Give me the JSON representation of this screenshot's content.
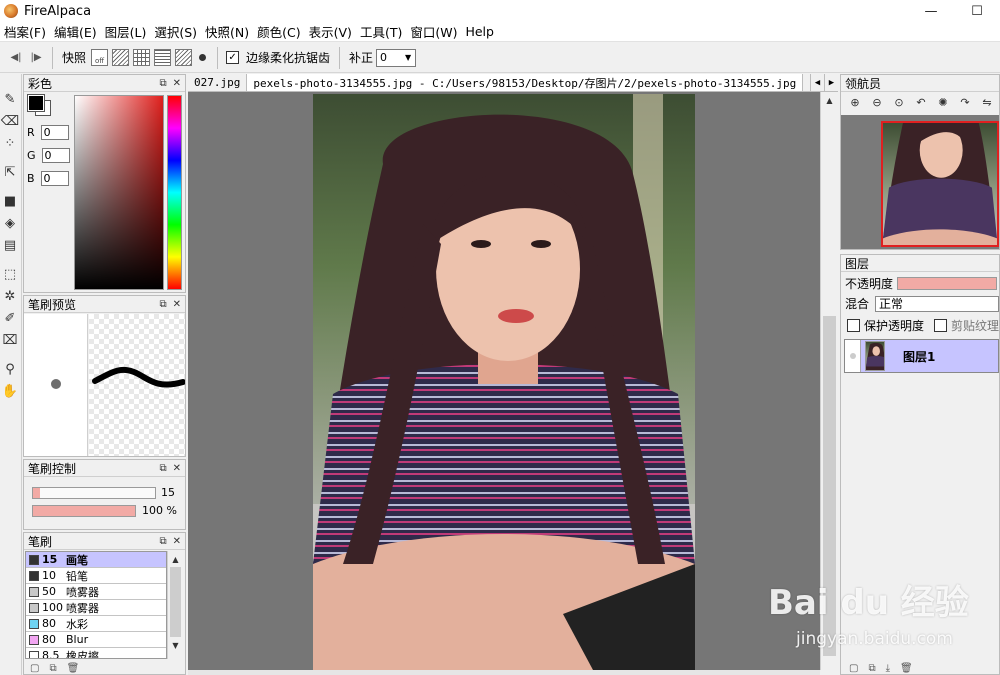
{
  "window": {
    "title": "FireAlpaca",
    "minimize": "—",
    "maximize": "☐"
  },
  "menu": [
    "档案(F)",
    "编辑(E)",
    "图层(L)",
    "選択(S)",
    "快照(N)",
    "颜色(C)",
    "表示(V)",
    "工具(T)",
    "窗口(W)",
    "Help"
  ],
  "toolbar": {
    "snap_label": "快照",
    "snap_off_text": "off",
    "antialias_checked": true,
    "antialias_label": "边缘柔化抗锯齿",
    "correction_label": "补正",
    "correction_value": "0"
  },
  "color_panel": {
    "title": "彩色",
    "r_label": "R",
    "r_value": "0",
    "g_label": "G",
    "g_value": "0",
    "b_label": "B",
    "b_value": "0",
    "fg_color": "#000000",
    "bg_color": "#ffffff",
    "hue_color": "#e0201d"
  },
  "brush_preview": {
    "title": "笔刷预览"
  },
  "brush_control": {
    "title": "笔刷控制",
    "size_value": "15",
    "size_fraction": 0.06,
    "opacity_value": "100 %",
    "opacity_fraction": 1.0
  },
  "brush_panel": {
    "title": "笔刷",
    "items": [
      {
        "size": "15",
        "name": "画笔",
        "chip": "#333333",
        "selected": true
      },
      {
        "size": "10",
        "name": "铅笔",
        "chip": "#333333",
        "selected": false
      },
      {
        "size": "50",
        "name": "喷雾器",
        "chip": "#c8c8c8",
        "selected": false
      },
      {
        "size": "100",
        "name": "喷雾器",
        "chip": "#c8c8c8",
        "selected": false
      },
      {
        "size": "80",
        "name": "水彩",
        "chip": "#6fd3f2",
        "selected": false
      },
      {
        "size": "80",
        "name": "Blur",
        "chip": "#f2a6f2",
        "selected": false
      },
      {
        "size": "8.5",
        "name": "橡皮擦",
        "chip": "#ffffff",
        "selected": false
      }
    ]
  },
  "document": {
    "tabs": [
      {
        "label": "027.jpg",
        "active": false
      },
      {
        "label": "pexels-photo-3134555.jpg - C:/Users/98153/Desktop/存图片/2/pexels-photo-3134555.jpg",
        "active": true
      }
    ]
  },
  "navigator": {
    "title": "领航员"
  },
  "layers": {
    "title": "图层",
    "opacity_label": "不透明度",
    "opacity_fraction": 1.0,
    "blend_label": "混合",
    "blend_value": "正常",
    "protect_label": "保护透明度",
    "protect_checked": false,
    "clip_label": "剪贴纹理",
    "clip_checked": false,
    "items": [
      {
        "name": "图层1",
        "selected": true
      }
    ]
  },
  "watermark": {
    "logo": "Bai du 经验",
    "url": "jingyan.baidu.com"
  }
}
